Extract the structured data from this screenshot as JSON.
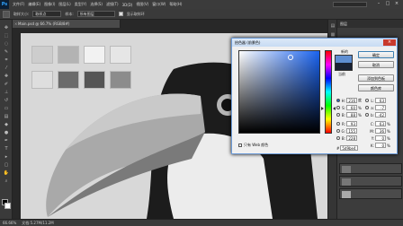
{
  "app": {
    "logo_text": "Ps"
  },
  "menu": [
    "文件(F)",
    "编辑(E)",
    "图像(I)",
    "图层(L)",
    "类型(Y)",
    "选择(S)",
    "滤镜(T)",
    "3D(D)",
    "视图(V)",
    "窗口(W)",
    "帮助(H)"
  ],
  "options_bar": {
    "sample_size_label": "取样大小:",
    "sample_size_value": "取样点",
    "sample_label": "样本:",
    "sample_value": "所有图层",
    "show_ring_label": "显示取样环"
  },
  "document": {
    "tab_label": "Main.psd @ 66.7% (RGB/8#)"
  },
  "status_bar": {
    "zoom": "66.66%",
    "doc_info": "文档:5.27M/11.2M"
  },
  "panels": {
    "layers_header": "图层"
  },
  "color_picker": {
    "title": "拾色器 (前景色)",
    "new_label": "新的",
    "current_label": "当前",
    "buttons": {
      "ok": "确定",
      "cancel": "取消",
      "add_swatch": "添加到色板",
      "color_libraries": "颜色库"
    },
    "fields": {
      "H": {
        "label": "H:",
        "value": "216",
        "unit": "度"
      },
      "S": {
        "label": "S:",
        "value": "60",
        "unit": "%"
      },
      "B": {
        "label": "B:",
        "value": "88",
        "unit": "%"
      },
      "R": {
        "label": "R:",
        "value": "93",
        "unit": ""
      },
      "G": {
        "label": "G:",
        "value": "155",
        "unit": ""
      },
      "Bl": {
        "label": "B:",
        "value": "228",
        "unit": ""
      },
      "L": {
        "label": "L:",
        "value": "63",
        "unit": ""
      },
      "a": {
        "label": "a:",
        "value": "-7",
        "unit": ""
      },
      "b": {
        "label": "b:",
        "value": "-42",
        "unit": ""
      },
      "C": {
        "label": "C:",
        "value": "63",
        "unit": "%"
      },
      "M": {
        "label": "M:",
        "value": "36",
        "unit": "%"
      },
      "Y": {
        "label": "Y:",
        "value": "0",
        "unit": "%"
      },
      "K": {
        "label": "K:",
        "value": "0",
        "unit": "%"
      }
    },
    "web_only_label": "只有 Web 颜色",
    "hex_label": "#",
    "hex_value": "5d9be4",
    "new_color": "#5e8ed1",
    "current_color": "#1a2233"
  }
}
